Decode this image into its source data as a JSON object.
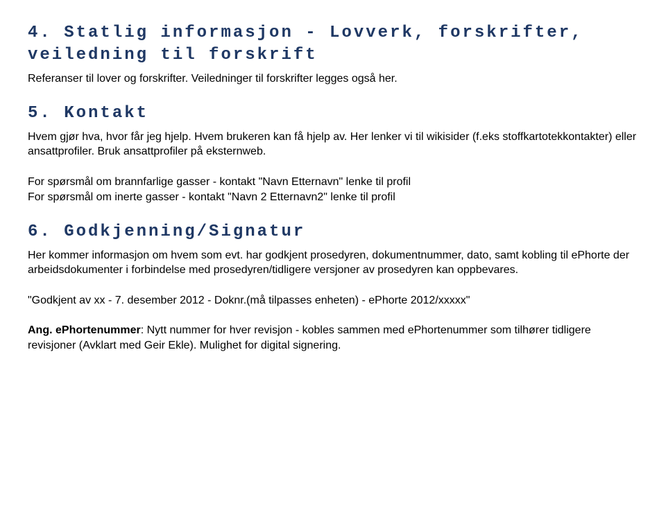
{
  "sec4": {
    "heading": "4. Statlig informasjon - Lovverk, forskrifter, veiledning til forskrift",
    "body": "Referanser til lover og forskrifter. Veiledninger til forskrifter legges også her."
  },
  "sec5": {
    "heading": "5. Kontakt",
    "body1": "Hvem gjør hva, hvor får jeg hjelp. Hvem brukeren kan få hjelp av. Her lenker vi til wikisider (f.eks stoffkartotekkontakter) eller ansattprofiler. Bruk ansattprofiler på eksternweb.",
    "body2": "For spørsmål om brannfarlige gasser - kontakt \"Navn Etternavn\" lenke til profil\nFor spørsmål om inerte gasser - kontakt \"Navn 2 Etternavn2\" lenke til profil"
  },
  "sec6": {
    "heading": "6. Godkjenning/Signatur",
    "body1": "Her kommer informasjon om hvem som evt. har godkjent prosedyren, dokumentnummer, dato, samt kobling til ePhorte der arbeidsdokumenter i forbindelse med prosedyren/tidligere versjoner av prosedyren kan oppbevares.",
    "body2": "\"Godkjent av xx - 7. desember 2012 - Doknr.(må tilpasses enheten) - ePhorte 2012/xxxxx\"",
    "ang_label": "Ang. ePhortenummer",
    "ang_rest": ": Nytt nummer for hver revisjon - kobles sammen med ePhortenummer som tilhører tidligere revisjoner (Avklart med Geir Ekle). Mulighet for digital signering."
  }
}
